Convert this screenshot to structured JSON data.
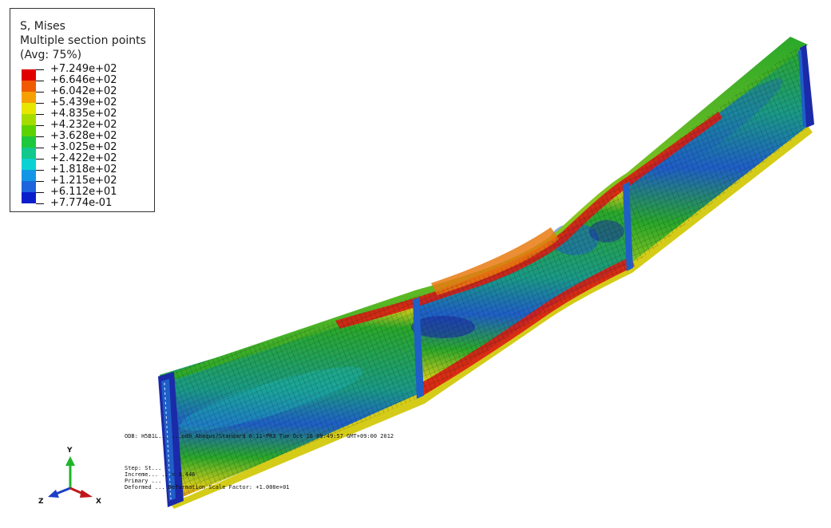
{
  "legend": {
    "title": "S, Mises",
    "subtitle": "Multiple section points",
    "averaging": "(Avg: 75%)",
    "entries": [
      {
        "value": "+7.249e+02",
        "color": "#e00000"
      },
      {
        "value": "+6.646e+02",
        "color": "#f05a00"
      },
      {
        "value": "+6.042e+02",
        "color": "#f5a000"
      },
      {
        "value": "+5.439e+02",
        "color": "#e6e600"
      },
      {
        "value": "+4.835e+02",
        "color": "#a5dc00"
      },
      {
        "value": "+4.232e+02",
        "color": "#5cd200"
      },
      {
        "value": "+3.628e+02",
        "color": "#1ec83c"
      },
      {
        "value": "+3.025e+02",
        "color": "#12c88c"
      },
      {
        "value": "+2.422e+02",
        "color": "#0ad2d2"
      },
      {
        "value": "+1.818e+02",
        "color": "#1496e6"
      },
      {
        "value": "+1.215e+02",
        "color": "#1e64dc"
      },
      {
        "value": "+6.112e+01",
        "color": "#0a1ecc"
      },
      {
        "value": "+7.774e-01",
        "color": null
      }
    ]
  },
  "info": {
    "odb_line": "ODB: H5B1L... ...odb   Abaqus/Standard 6.11-PR3   Tue Oct 16 09:49:57 GMT+09:00 2012",
    "step_line": "Step: St...",
    "increment_line": "Increme...               ...= 3.446",
    "primary_line": "Primary ...",
    "deformed_line": "Deformed ...  Deformation Scale Factor: +1.000e+01"
  },
  "triad": {
    "y_label": "Y",
    "z_label": "Z",
    "x_label": "X",
    "y_color": "#1fb52b",
    "z_color": "#1b3fc4",
    "x_color": "#c0161a"
  },
  "model": {
    "colors": {
      "red": "#d81c14",
      "orange": "#e87a10",
      "yellow": "#d4cc18",
      "lime": "#8ec81e",
      "green": "#2aa82a",
      "teal": "#1a9a86",
      "cyan": "#1cb6c0",
      "blue": "#1f5fc8",
      "navy": "#1a2aa8"
    }
  }
}
